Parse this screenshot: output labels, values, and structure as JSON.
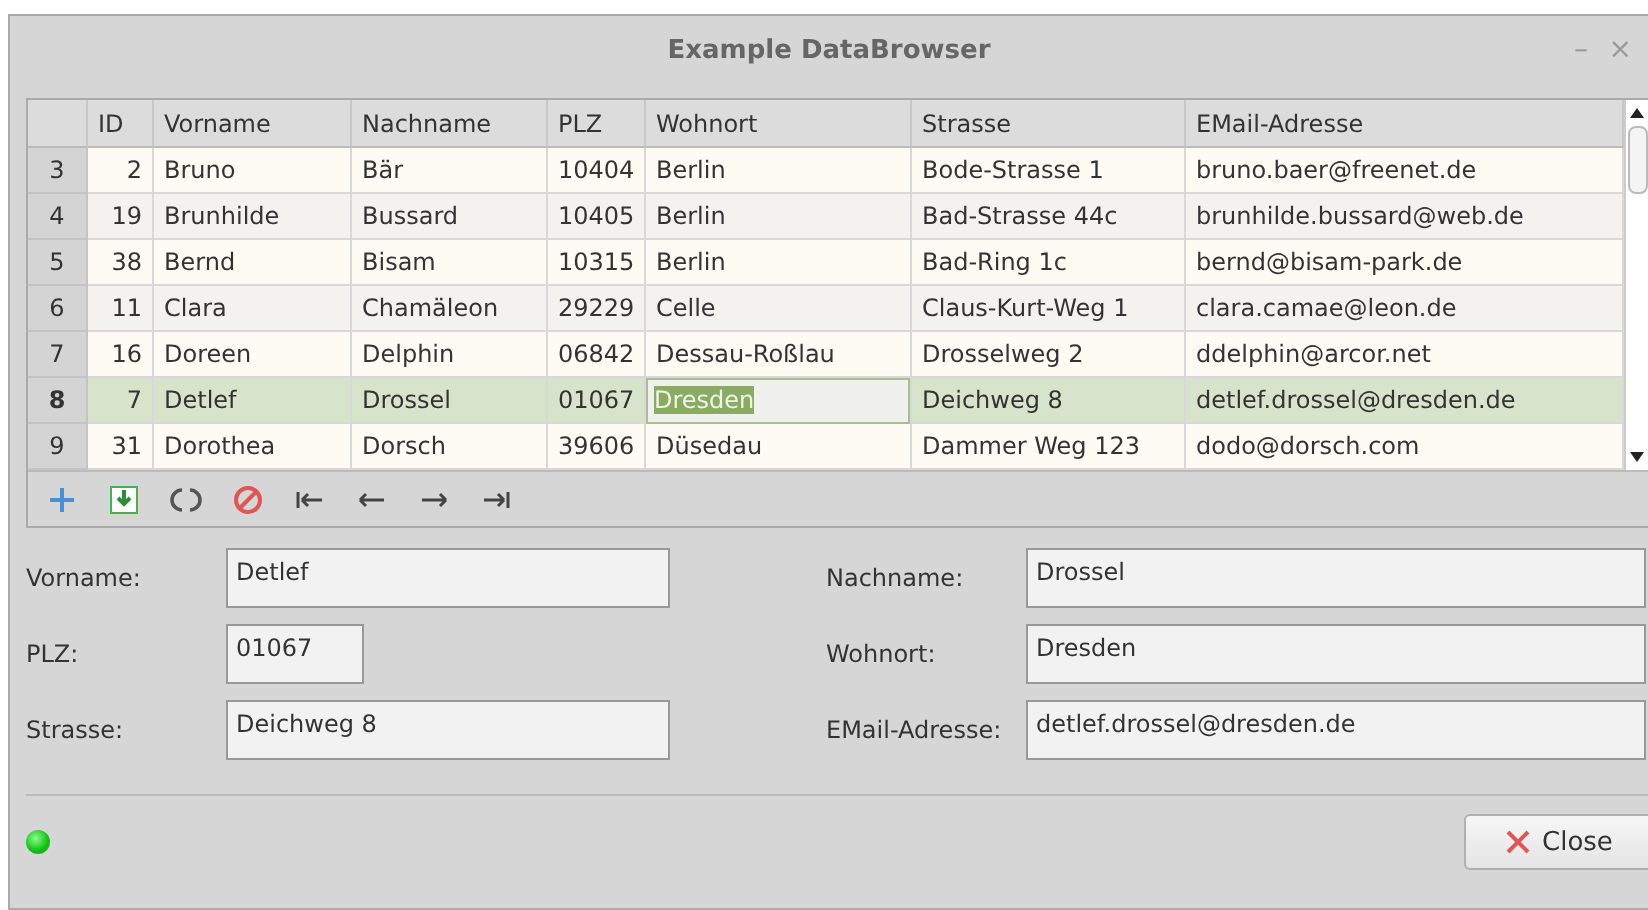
{
  "window": {
    "title": "Example DataBrowser",
    "controls": [
      "–",
      "×"
    ]
  },
  "table": {
    "columns": [
      "ID",
      "Vorname",
      "Nachname",
      "PLZ",
      "Wohnort",
      "Strasse",
      "EMail-Adresse"
    ],
    "rows": [
      {
        "number": "3",
        "selected": false,
        "cells": [
          {
            "text": "2",
            "editing": false
          },
          {
            "text": "Bruno",
            "editing": false
          },
          {
            "text": "Bär",
            "editing": false
          },
          {
            "text": "10404",
            "editing": false
          },
          {
            "text": "Berlin",
            "editing": false
          },
          {
            "text": "Bode-Strasse 1",
            "editing": false
          },
          {
            "text": "bruno.baer@freenet.de",
            "editing": false
          }
        ]
      },
      {
        "number": "4",
        "selected": false,
        "cells": [
          {
            "text": "19",
            "editing": false
          },
          {
            "text": "Brunhilde",
            "editing": false
          },
          {
            "text": "Bussard",
            "editing": false
          },
          {
            "text": "10405",
            "editing": false
          },
          {
            "text": "Berlin",
            "editing": false
          },
          {
            "text": "Bad-Strasse 44c",
            "editing": false
          },
          {
            "text": "brunhilde.bussard@web.de",
            "editing": false
          }
        ]
      },
      {
        "number": "5",
        "selected": false,
        "cells": [
          {
            "text": "38",
            "editing": false
          },
          {
            "text": "Bernd",
            "editing": false
          },
          {
            "text": "Bisam",
            "editing": false
          },
          {
            "text": "10315",
            "editing": false
          },
          {
            "text": "Berlin",
            "editing": false
          },
          {
            "text": "Bad-Ring 1c",
            "editing": false
          },
          {
            "text": "bernd@bisam-park.de",
            "editing": false
          }
        ]
      },
      {
        "number": "6",
        "selected": false,
        "cells": [
          {
            "text": "11",
            "editing": false
          },
          {
            "text": "Clara",
            "editing": false
          },
          {
            "text": "Chamäleon",
            "editing": false
          },
          {
            "text": "29229",
            "editing": false
          },
          {
            "text": "Celle",
            "editing": false
          },
          {
            "text": "Claus-Kurt-Weg 1",
            "editing": false
          },
          {
            "text": "clara.camae@leon.de",
            "editing": false
          }
        ]
      },
      {
        "number": "7",
        "selected": false,
        "cells": [
          {
            "text": "16",
            "editing": false
          },
          {
            "text": "Doreen",
            "editing": false
          },
          {
            "text": "Delphin",
            "editing": false
          },
          {
            "text": "06842",
            "editing": false
          },
          {
            "text": "Dessau-Roßlau",
            "editing": false
          },
          {
            "text": "Drosselweg 2",
            "editing": false
          },
          {
            "text": "ddelphin@arcor.net",
            "editing": false
          }
        ]
      },
      {
        "number": "8",
        "selected": true,
        "cells": [
          {
            "text": "7",
            "editing": false
          },
          {
            "text": "Detlef",
            "editing": false
          },
          {
            "text": "Drossel",
            "editing": false
          },
          {
            "text": "01067",
            "editing": false
          },
          {
            "text": "Dresden",
            "editing": true
          },
          {
            "text": "Deichweg 8",
            "editing": false
          },
          {
            "text": "detlef.drossel@dresden.de",
            "editing": false
          }
        ]
      },
      {
        "number": "9",
        "selected": false,
        "cells": [
          {
            "text": "31",
            "editing": false
          },
          {
            "text": "Dorothea",
            "editing": false
          },
          {
            "text": "Dorsch",
            "editing": false
          },
          {
            "text": "39606",
            "editing": false
          },
          {
            "text": "Düsedau",
            "editing": false
          },
          {
            "text": "Dammer Weg 123",
            "editing": false
          },
          {
            "text": "dodo@dorsch.com",
            "editing": false
          }
        ]
      }
    ]
  },
  "toolbar": [
    {
      "kind": "add"
    },
    {
      "kind": "save"
    },
    {
      "kind": "refresh"
    },
    {
      "kind": "cancel"
    },
    {
      "kind": "first"
    },
    {
      "kind": "prev"
    },
    {
      "kind": "next"
    },
    {
      "kind": "last"
    }
  ],
  "form": [
    {
      "label": "Vorname:",
      "value": "Detlef"
    },
    {
      "label": "Nachname:",
      "value": "Drossel"
    },
    {
      "label": "PLZ:",
      "value": "01067"
    },
    {
      "label": "Wohnort:",
      "value": "Dresden"
    },
    {
      "label": "Strasse:",
      "value": "Deichweg 8"
    },
    {
      "label": "EMail-Adresse:",
      "value": "detlef.drossel@dresden.de"
    }
  ],
  "status": {
    "on": true
  },
  "close_button": {
    "label": "Close"
  }
}
